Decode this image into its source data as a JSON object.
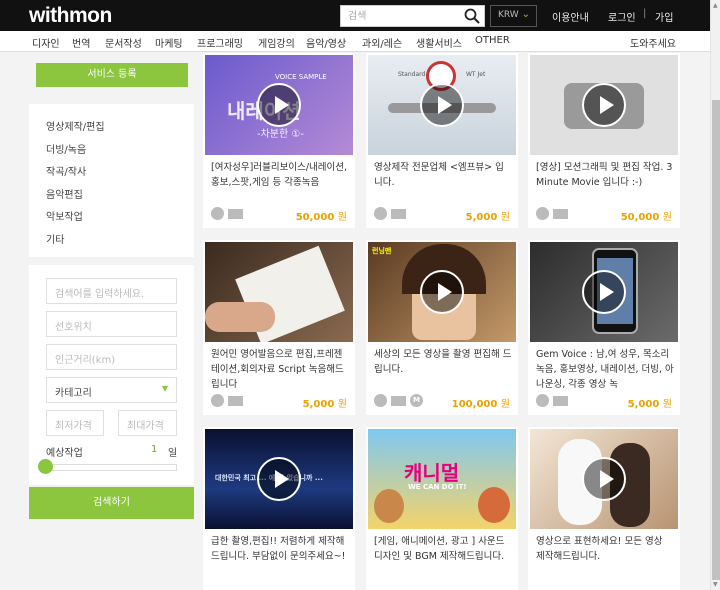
{
  "header": {
    "logo_text": "withmon",
    "search_placeholder": "검색",
    "currency": "KRW",
    "nav": [
      "이용안내",
      "로그인",
      "가입"
    ],
    "separator": "|"
  },
  "categories": [
    "디자인",
    "번역",
    "문서작성",
    "마케팅",
    "프로그래밍",
    "게임강의",
    "음악/영상",
    "과외/레슨",
    "생활서비스",
    "OTHER",
    "도와주세요"
  ],
  "sidebar": {
    "register_label": "서비스 등록",
    "items": [
      "영상제작/편집",
      "더빙/녹음",
      "작곡/작사",
      "음악편집",
      "악보작업",
      "기타"
    ]
  },
  "filters": {
    "keyword_placeholder": "검색어를 입력하세요.",
    "location_placeholder": "선호위치",
    "distance_placeholder": "인근거리(km)",
    "category_label": "카테고리",
    "min_price_placeholder": "최저가격",
    "max_price_placeholder": "최대가격",
    "days_label": "예상작업",
    "days_value": "1",
    "days_unit": "일",
    "search_label": "검색하기"
  },
  "cards": [
    {
      "title": "[여자성우]러블리보이스/내레이션,홍보,스팟,게임 등 각종녹음",
      "price": "50,000",
      "currency": "원",
      "video": true,
      "m_icon": false
    },
    {
      "title": "영상제작 전문업체 <엠프뷰> 입니다.",
      "price": "5,000",
      "currency": "원",
      "video": true,
      "m_icon": false
    },
    {
      "title": "[영상] 모션그래픽 및 편집 작업. 3 Minute Movie 입니다 :-)",
      "price": "50,000",
      "currency": "원",
      "video": true,
      "m_icon": false
    },
    {
      "title": "원어민 영어발음으로 편집,프레젠테이션,회의자료 Script 녹음해드립니다",
      "price": "5,000",
      "currency": "원",
      "video": false,
      "m_icon": false
    },
    {
      "title": "세상의 모든 영상을 촬영 편집해 드립니다.",
      "price": "100,000",
      "currency": "원",
      "video": true,
      "m_icon": true
    },
    {
      "title": "Gem Voice : 남,여 성우, 목소리 녹음, 홍보영상, 내레이션, 더빙, 아나운싱, 각종 영상 녹",
      "price": "5,000",
      "currency": "원",
      "video": true,
      "m_icon": false
    },
    {
      "title": "급한 촬영,편집!! 저렴하게 제작해드립니다. 부담없이 문의주세요~!",
      "price": "",
      "currency": "",
      "video": true,
      "m_icon": false
    },
    {
      "title": "[게임, 애니메이션, 광고 ] 사운드디자인 및 BGM 제작해드립니다.",
      "price": "",
      "currency": "",
      "video": true,
      "m_icon": false
    },
    {
      "title": "영상으로 표현하세요! 모든 영상 제작해드립니다.",
      "price": "",
      "currency": "",
      "video": true,
      "m_icon": false
    }
  ],
  "thumb_texts": {
    "c1_sample": "VOICE SAMPLE",
    "c1_title": "내레이션",
    "c1_sub": "-차분한 ①-",
    "c2_left": "Standard",
    "c2_right": "WT Jet",
    "c5_badge": "런닝맨",
    "c7_caption": "대한민국 최고 ... 에 와 있습니까 ...",
    "c8_logo": "캐니멀",
    "c8_sub": "WE CAN DO IT!"
  },
  "colors": {
    "accent": "#8cc63f",
    "price": "#e8a200",
    "header_bg": "#111111"
  }
}
